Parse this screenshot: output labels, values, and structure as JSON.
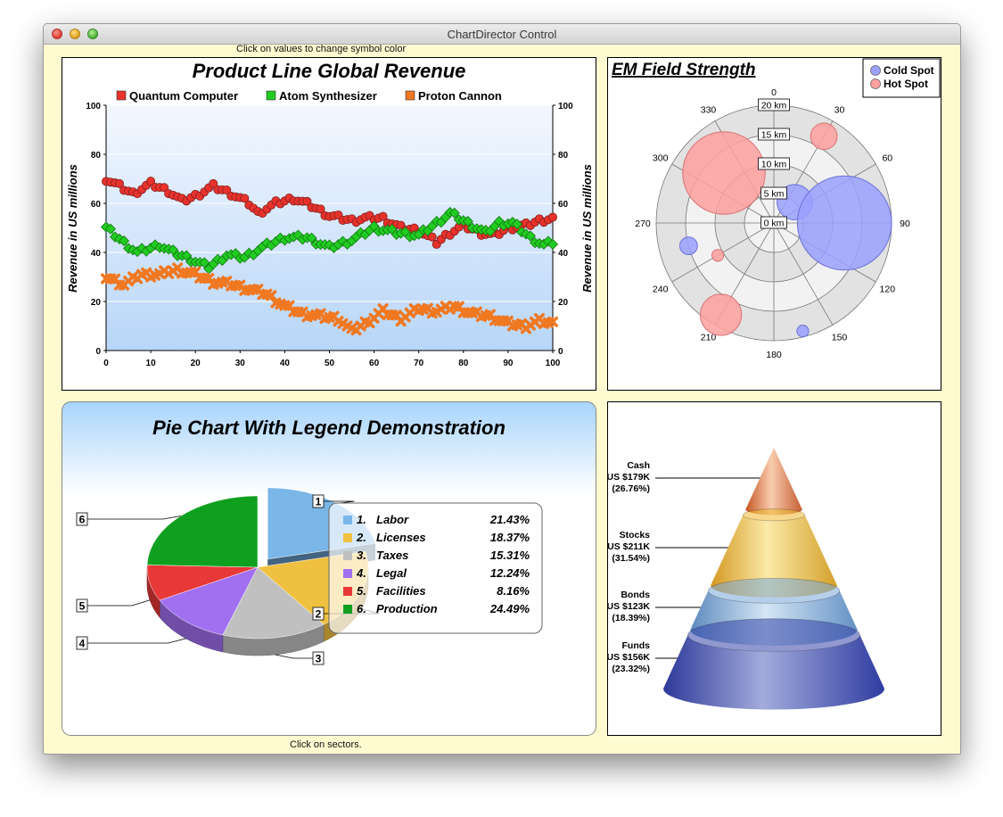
{
  "window": {
    "title": "ChartDirector Control",
    "hint_top": "Click on values to change symbol color",
    "hint_bottom": "Click on sectors."
  },
  "chart_data": [
    {
      "type": "line",
      "title": "Product Line Global Revenue",
      "ylabel": "Revenue in US millions",
      "ylabel_right": "Revenue in US millions",
      "xlim": [
        0,
        100
      ],
      "ylim": [
        0,
        100
      ],
      "x_ticks": [
        "0",
        "10",
        "20",
        "30",
        "40",
        "50",
        "60",
        "70",
        "80",
        "90",
        "100"
      ],
      "y_ticks": [
        "0",
        "20",
        "40",
        "60",
        "80",
        "100"
      ],
      "grid": true,
      "legend_position": "top",
      "colors": {
        "Quantum Computer": "#e8322b",
        "Atom Synthesizer": "#22cc22",
        "Proton Cannon": "#f07820"
      },
      "series": [
        {
          "name": "Quantum Computer",
          "keypoints": [
            [
              0,
              70
            ],
            [
              3,
              67
            ],
            [
              6,
              64
            ],
            [
              10,
              68
            ],
            [
              14,
              65
            ],
            [
              17,
              61
            ],
            [
              20,
              63
            ],
            [
              24,
              67
            ],
            [
              28,
              64
            ],
            [
              32,
              60
            ],
            [
              34,
              56
            ],
            [
              38,
              60
            ],
            [
              42,
              62
            ],
            [
              46,
              59
            ],
            [
              50,
              55
            ],
            [
              55,
              53
            ],
            [
              58,
              54
            ],
            [
              62,
              54
            ],
            [
              66,
              50
            ],
            [
              70,
              49
            ],
            [
              74,
              44
            ],
            [
              77,
              48
            ],
            [
              80,
              51
            ],
            [
              84,
              48
            ],
            [
              87,
              47
            ],
            [
              90,
              50
            ],
            [
              94,
              51
            ],
            [
              97,
              53
            ],
            [
              100,
              54
            ]
          ]
        },
        {
          "name": "Atom Synthesizer",
          "keypoints": [
            [
              0,
              50
            ],
            [
              4,
              44
            ],
            [
              7,
              40
            ],
            [
              12,
              43
            ],
            [
              15,
              40
            ],
            [
              18,
              38
            ],
            [
              23,
              34
            ],
            [
              27,
              39
            ],
            [
              31,
              38
            ],
            [
              35,
              42
            ],
            [
              40,
              46
            ],
            [
              45,
              46
            ],
            [
              50,
              42
            ],
            [
              55,
              45
            ],
            [
              60,
              50
            ],
            [
              65,
              48
            ],
            [
              70,
              47
            ],
            [
              74,
              52
            ],
            [
              77,
              56
            ],
            [
              81,
              52
            ],
            [
              85,
              48
            ],
            [
              88,
              52
            ],
            [
              91,
              52
            ],
            [
              95,
              46
            ],
            [
              98,
              43
            ],
            [
              100,
              44
            ]
          ]
        },
        {
          "name": "Proton Cannon",
          "keypoints": [
            [
              0,
              30
            ],
            [
              4,
              27
            ],
            [
              8,
              31
            ],
            [
              12,
              31
            ],
            [
              16,
              33
            ],
            [
              20,
              31
            ],
            [
              24,
              28
            ],
            [
              28,
              27
            ],
            [
              32,
              25
            ],
            [
              36,
              23
            ],
            [
              40,
              18
            ],
            [
              44,
              15
            ],
            [
              48,
              14
            ],
            [
              52,
              13
            ],
            [
              55,
              8
            ],
            [
              58,
              11
            ],
            [
              62,
              16
            ],
            [
              66,
              13
            ],
            [
              70,
              17
            ],
            [
              74,
              16
            ],
            [
              78,
              18
            ],
            [
              82,
              15
            ],
            [
              86,
              14
            ],
            [
              90,
              11
            ],
            [
              94,
              10
            ],
            [
              97,
              12
            ],
            [
              100,
              11
            ]
          ]
        }
      ]
    },
    {
      "type": "scatter",
      "subtype": "polar-bubble",
      "title": "EM Field Strength",
      "angle_labels": [
        "0",
        "30",
        "60",
        "90",
        "120",
        "150",
        "180",
        "210",
        "240",
        "270",
        "300",
        "330"
      ],
      "radial_labels": [
        "0 km",
        "5 km",
        "10 km",
        "15 km",
        "20 km"
      ],
      "radial_range": [
        0,
        20
      ],
      "legend_position": "top-right",
      "series": [
        {
          "name": "Cold Spot",
          "color": "#9aa0ff",
          "points": [
            {
              "angle": 45,
              "r": 5,
              "size": 6
            },
            {
              "angle": 90,
              "r": 12,
              "size": 16
            },
            {
              "angle": 255,
              "r": 15,
              "size": 3
            },
            {
              "angle": 165,
              "r": 19,
              "size": 2
            }
          ]
        },
        {
          "name": "Hot Spot",
          "color": "#ffa0a0",
          "points": [
            {
              "angle": 315,
              "r": 12,
              "size": 14
            },
            {
              "angle": 30,
              "r": 17,
              "size": 4.5
            },
            {
              "angle": 240,
              "r": 11,
              "size": 2
            },
            {
              "angle": 210,
              "r": 18,
              "size": 7
            }
          ]
        }
      ]
    },
    {
      "type": "pie",
      "title": "Pie Chart With Legend Demonstration",
      "categories": [
        "Labor",
        "Licenses",
        "Taxes",
        "Legal",
        "Facilities",
        "Production"
      ],
      "values": [
        21.43,
        18.37,
        15.31,
        12.24,
        8.16,
        24.49
      ],
      "numbers": [
        "1.",
        "2.",
        "3.",
        "4.",
        "5.",
        "6."
      ],
      "percent_labels": [
        "21.43%",
        "18.37%",
        "15.31%",
        "12.24%",
        "8.16%",
        "24.49%"
      ],
      "sector_labels": [
        "1",
        "2",
        "3",
        "4",
        "5",
        "6"
      ],
      "exploded": [
        0
      ],
      "colors": [
        "#7ab6e8",
        "#f0c040",
        "#c0c0c0",
        "#a070f0",
        "#e83838",
        "#10a020"
      ],
      "legend_position": "right"
    },
    {
      "type": "other",
      "subtype": "cone",
      "categories": [
        "Cash",
        "Stocks",
        "Bonds",
        "Funds"
      ],
      "value_labels": [
        "US $179K",
        "US $211K",
        "US $123K",
        "US $156K"
      ],
      "percent_labels": [
        "(26.76%)",
        "(31.54%)",
        "(18.39%)",
        "(23.32%)"
      ],
      "values": [
        179,
        211,
        123,
        156
      ],
      "colors": [
        "#e07840",
        "#f0b830",
        "#78a8d8",
        "#3444a8"
      ]
    }
  ]
}
